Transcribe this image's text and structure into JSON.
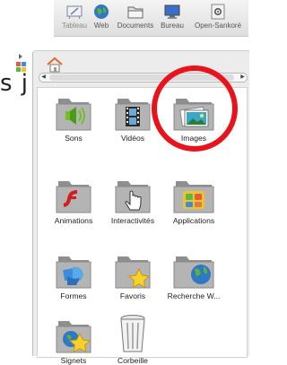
{
  "background": {
    "text": "s j"
  },
  "toolbar": {
    "items": [
      {
        "label": "Tableau",
        "icon": "board-icon"
      },
      {
        "label": "Web",
        "icon": "globe-icon"
      },
      {
        "label": "Documents",
        "icon": "folder-icon"
      },
      {
        "label": "Bureau",
        "icon": "monitor-icon"
      },
      {
        "label": "Open-Sankoré",
        "icon": "gear-icon"
      }
    ]
  },
  "library": {
    "items": [
      {
        "label": "Sons",
        "icon": "sound-folder-icon"
      },
      {
        "label": "Vidéos",
        "icon": "video-folder-icon"
      },
      {
        "label": "Images",
        "icon": "image-folder-icon"
      },
      {
        "label": "Animations",
        "icon": "flash-folder-icon"
      },
      {
        "label": "Interactivités",
        "icon": "hand-folder-icon"
      },
      {
        "label": "Applications",
        "icon": "apps-folder-icon"
      },
      {
        "label": "Formes",
        "icon": "shapes-folder-icon"
      },
      {
        "label": "Favoris",
        "icon": "star-folder-icon"
      },
      {
        "label": "Recherche W...",
        "icon": "web-search-folder-icon"
      },
      {
        "label": "Signets",
        "icon": "bookmark-folder-icon"
      },
      {
        "label": "Corbeille",
        "icon": "trash-icon"
      }
    ]
  },
  "colors": {
    "highlight": "#e8131b",
    "panel": "#ececec",
    "folder": "#9a9a9a"
  }
}
